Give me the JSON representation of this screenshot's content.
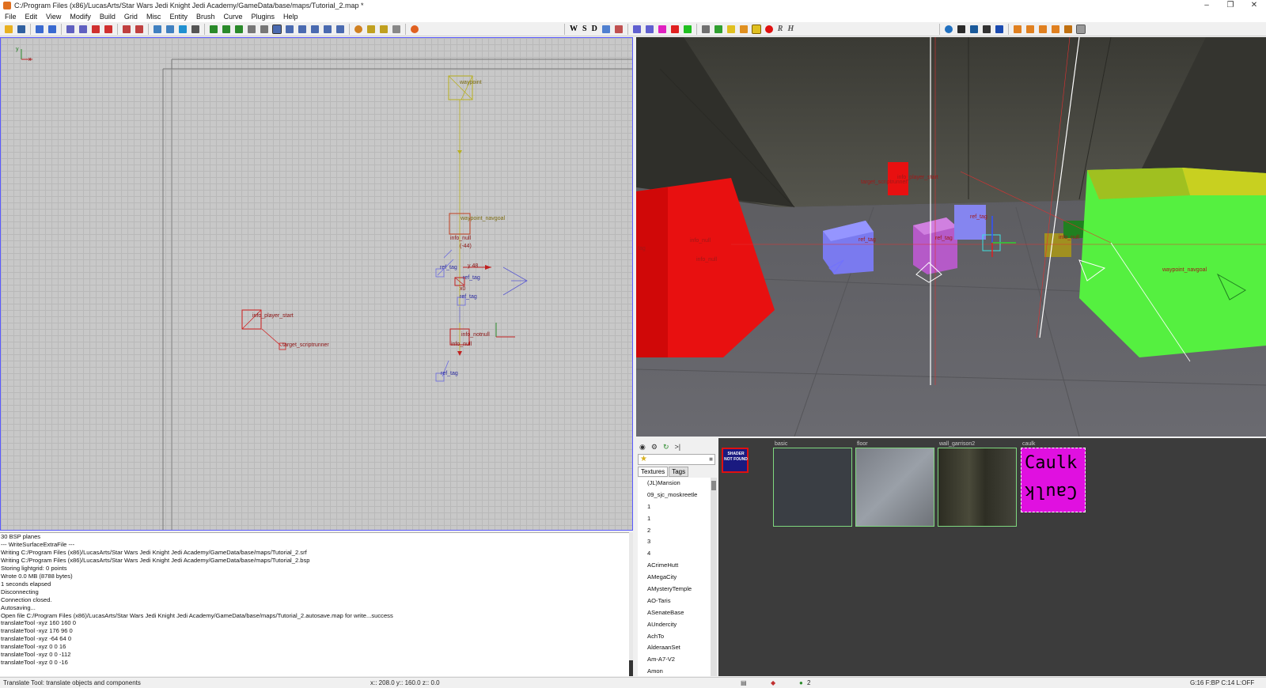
{
  "window": {
    "title": "C:/Program Files (x86)/LucasArts/Star Wars Jedi Knight Jedi Academy/GameData/base/maps/Tutorial_2.map *",
    "controls": [
      "–",
      "❐",
      "✕"
    ]
  },
  "menubar": [
    "File",
    "Edit",
    "View",
    "Modify",
    "Build",
    "Grid",
    "Misc",
    "Entity",
    "Brush",
    "Curve",
    "Plugins",
    "Help"
  ],
  "toolbar": {
    "letters": [
      "W",
      "S",
      "D"
    ],
    "italic_letters": [
      "R",
      "H"
    ]
  },
  "view2d": {
    "axis_y": "y",
    "axis_x": "x",
    "entities": {
      "waypoint": "waypoint",
      "waypoint_navgoal": "waypoint_navgoal",
      "info_null_1": "info_null",
      "ref_tag_1": "ref_tag",
      "ref_tag_2": "ref_tag",
      "ref_tag_3": "ref_tag",
      "ref_tag_4": "ref_tag",
      "info_player_start": "info_player_start",
      "target_scriptrunner": "target_scriptrunner",
      "info_notnull": "info_notnull",
      "info_null_2": "info_null",
      "coord_44": "(-44)",
      "y48": "y 48",
      "x0": "x0"
    }
  },
  "view3d": {
    "labels": {
      "info_player_start": "info_player_start",
      "target_scriptrunner": "target_scriptrunner",
      "ref_tag_a": "ref_tag",
      "ref_tag_b": "ref_tag",
      "ref_tag_c": "ref_tag",
      "info_null_a": "info_null",
      "info_null_b": "info_null",
      "info_null_c": "info_null",
      "waypoint_navgoal": "waypoint_navgoal",
      "tag": "tag"
    }
  },
  "console": {
    "lines": [
      "     30 BSP planes",
      "--- WriteSurfaceExtraFile ---",
      "Writing C:/Program Files (x86)/LucasArts/Star Wars Jedi Knight Jedi Academy/GameData/base/maps/Tutorial_2.srf",
      "Writing C:/Program Files (x86)/LucasArts/Star Wars Jedi Knight Jedi Academy/GameData/base/maps/Tutorial_2.bsp",
      "Storing lightgrid: 0 points",
      "Wrote 0.0 MB (8788 bytes)",
      "       1 seconds elapsed",
      "Disconnecting",
      "Connection closed.",
      "Autosaving...",
      "Open file C:/Program Files (x86)/LucasArts/Star Wars Jedi Knight Jedi Academy/GameData/base/maps/Tutorial_2.autosave.map for write...success",
      "translateTool -xyz 160 160 0",
      "translateTool -xyz 176 96 0",
      "translateTool -xyz -64 64 0",
      "translateTool -xyz 0 0 16",
      "translateTool -xyz 0 0 -112",
      "translateTool -xyz 0 0 -16"
    ]
  },
  "textures": {
    "tabs": [
      "Textures",
      "Tags"
    ],
    "list": [
      "(JL)Mansion",
      "09_sjc_moskreetle",
      "1",
      "1",
      "2",
      "3",
      "4",
      "ACrimeHutt",
      "AMegaCity",
      "AMysteryTemple",
      "AO-Taris",
      "ASenateBase",
      "AUndercity",
      "AchTo",
      "AlderaanSet",
      "Am-A7-V2",
      "Amon"
    ],
    "thumbs": {
      "missing": "SHADER NOT FOUND",
      "basic": "basic",
      "floor": "floor",
      "wall_garrison2": "wall_garrison2",
      "caulk": "caulk",
      "caulk_text": "Caulk"
    }
  },
  "statusbar": {
    "hint": "Translate Tool: translate objects and components",
    "coords": "x:: 208.0  y:: 160.0  z::   0.0",
    "count": "2",
    "grid": "G:16  F:BP  C:14  L:OFF"
  }
}
